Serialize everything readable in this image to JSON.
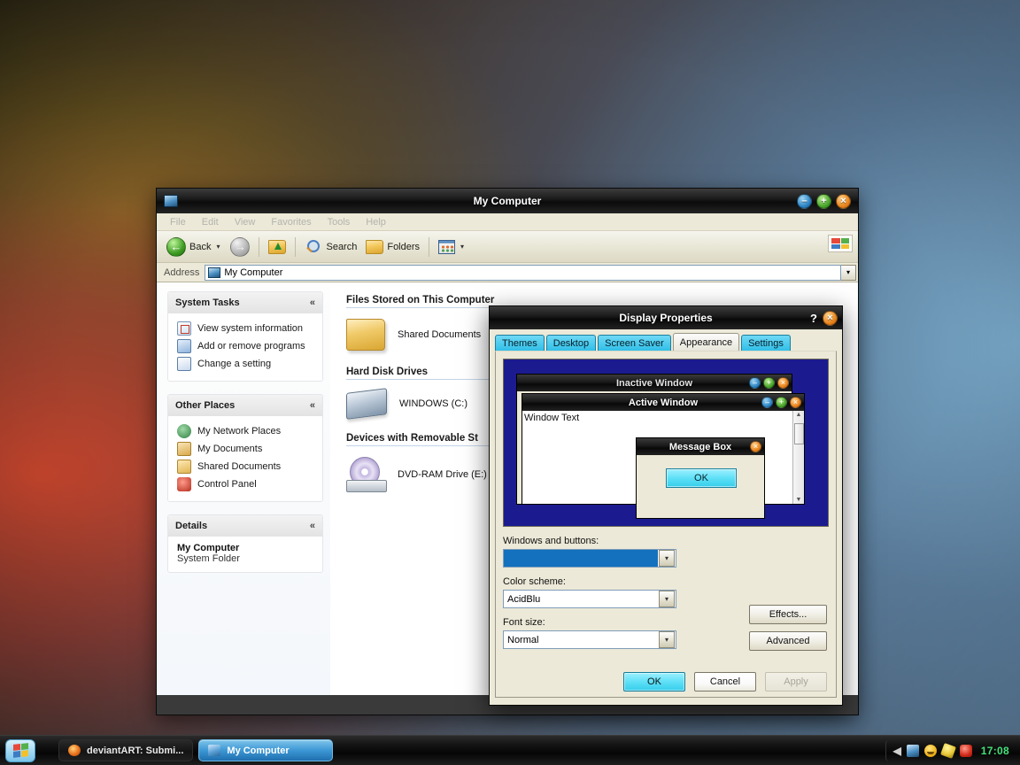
{
  "desktop": {
    "wallpaper_colors": {
      "upper_left": "#1b1a10",
      "left_orange": "#cd462d",
      "right_blue": "#6f93b2",
      "mid_grey": "#4e4a50"
    }
  },
  "explorer": {
    "title": "My Computer",
    "icon": "my-computer-icon",
    "window_buttons": [
      {
        "name": "minimize",
        "glyph": "–"
      },
      {
        "name": "maximize",
        "glyph": "+"
      },
      {
        "name": "close",
        "glyph": "×"
      }
    ],
    "menu": [
      "File",
      "Edit",
      "View",
      "Favorites",
      "Tools",
      "Help"
    ],
    "toolbar": {
      "back_label": "Back",
      "back_caret": "▾",
      "forward_glyph": "→",
      "back_glyph": "←",
      "up_icon": "folder-up-icon",
      "search_label": "Search",
      "folders_label": "Folders",
      "views_caret": "▾"
    },
    "address": {
      "label": "Address",
      "value": "My Computer",
      "dropdown_glyph": "▾"
    },
    "sidebar": {
      "panels": [
        {
          "title": "System Tasks",
          "collapse_glyph": "«",
          "items": [
            {
              "label": "View system information",
              "icon": "system-info-icon"
            },
            {
              "label": "Add or remove programs",
              "icon": "add-remove-programs-icon"
            },
            {
              "label": "Change a setting",
              "icon": "change-setting-icon"
            }
          ]
        },
        {
          "title": "Other Places",
          "collapse_glyph": "«",
          "items": [
            {
              "label": "My Network Places",
              "icon": "network-places-icon"
            },
            {
              "label": "My Documents",
              "icon": "my-documents-icon"
            },
            {
              "label": "Shared Documents",
              "icon": "shared-documents-icon"
            },
            {
              "label": "Control Panel",
              "icon": "control-panel-icon"
            }
          ]
        },
        {
          "title": "Details",
          "collapse_glyph": "«",
          "details_name": "My Computer",
          "details_type": "System Folder"
        }
      ]
    },
    "content": {
      "groups": [
        {
          "title": "Files Stored on This Computer",
          "items": [
            {
              "label": "Shared Documents",
              "icon": "folder-icon"
            }
          ]
        },
        {
          "title": "Hard Disk Drives",
          "items": [
            {
              "label": "WINDOWS (C:)",
              "icon": "hard-disk-icon"
            }
          ]
        },
        {
          "title": "Devices with Removable St",
          "items": [
            {
              "label": "DVD-RAM Drive (E:)",
              "icon": "dvd-drive-icon"
            }
          ]
        }
      ]
    }
  },
  "dialog": {
    "title": "Display Properties",
    "help_glyph": "?",
    "close_glyph": "×",
    "tabs": [
      {
        "label": "Themes",
        "active": false
      },
      {
        "label": "Desktop",
        "active": false
      },
      {
        "label": "Screen Saver",
        "active": false
      },
      {
        "label": "Appearance",
        "active": true
      },
      {
        "label": "Settings",
        "active": false
      }
    ],
    "preview": {
      "background_color": "#1b1b8f",
      "inactive_window_title": "Inactive Window",
      "active_window_title": "Active Window",
      "window_text": "Window Text",
      "message_box_title": "Message Box",
      "message_box_button": "OK",
      "min_glyph": "–",
      "max_glyph": "+",
      "close_glyph": "×",
      "scroll_up_glyph": "▲",
      "scroll_down_glyph": "▼"
    },
    "fields": {
      "windows_and_buttons_label": "Windows and buttons:",
      "windows_and_buttons_value": "",
      "color_scheme_label": "Color scheme:",
      "color_scheme_value": "AcidBlu",
      "font_size_label": "Font size:",
      "font_size_value": "Normal",
      "dropdown_glyph": "▾",
      "selection_color": "#1471bd"
    },
    "buttons": {
      "effects": "Effects...",
      "advanced": "Advanced",
      "ok": "OK",
      "cancel": "Cancel",
      "apply": "Apply"
    }
  },
  "taskbar": {
    "start_label": "start",
    "tasks": [
      {
        "label": "deviantART: Submi...",
        "icon": "firefox-icon",
        "active": false
      },
      {
        "label": "My Computer",
        "icon": "my-computer-icon",
        "active": true
      }
    ],
    "tray": {
      "chevron_glyph": "◀",
      "icons": [
        "network-icon",
        "messenger-icon",
        "magic-wand-icon",
        "alert-icon"
      ],
      "clock": "17:08"
    }
  }
}
